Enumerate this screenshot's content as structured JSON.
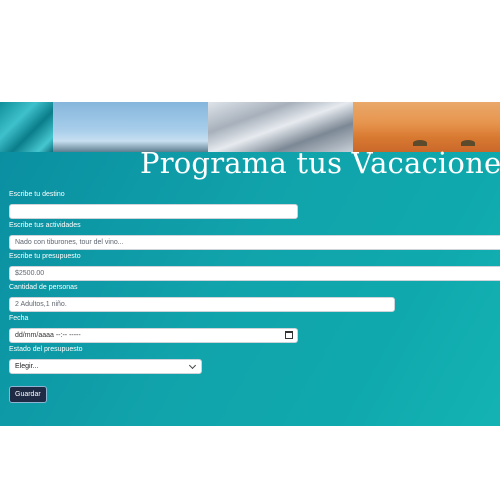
{
  "header": {
    "title": "Programa tus Vacaciones"
  },
  "form": {
    "destino": {
      "label": "Escribe tu destino",
      "value": ""
    },
    "actividades": {
      "label": "Escribe tus actividades",
      "placeholder": "Nado con tiburones, tour del vino..."
    },
    "presupuesto": {
      "label": "Escribe tu presupuesto",
      "placeholder": "$2500.00"
    },
    "personas": {
      "label": "Cantidad de personas",
      "placeholder": "2 Adultos,1 niño."
    },
    "fecha": {
      "label": "Fecha",
      "value": "dd/mm/aaaa --:-- -----"
    },
    "estado": {
      "label": "Estado del presupuesto",
      "selected": "Elegir..."
    },
    "save_label": "Guardar"
  },
  "colors": {
    "panel": "#0fa5ad",
    "button": "#1f2a44",
    "title": "#ffffff"
  },
  "icons": [
    "calendar-icon",
    "chevron-down-icon"
  ]
}
